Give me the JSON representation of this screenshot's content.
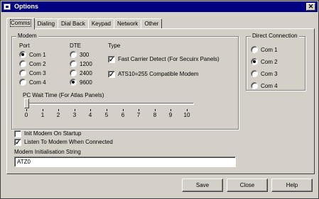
{
  "window": {
    "title": "Options",
    "close_label": "✕"
  },
  "tabs": [
    "Comms",
    "Dialing",
    "Dial Back",
    "Keypad",
    "Network",
    "Other"
  ],
  "active_tab": 0,
  "modem": {
    "group_label": "Modem",
    "port_header": "Port",
    "ports": [
      "Com 1",
      "Com 2",
      "Com 3",
      "Com 4"
    ],
    "selected_port": 0,
    "dte_header": "DTE",
    "dte_rates": [
      "300",
      "1200",
      "2400",
      "9600"
    ],
    "selected_dte": 3,
    "type_header": "Type",
    "types": [
      {
        "label": "Fast Carrier Detect (For Secuirx Panels)",
        "checked": true
      },
      {
        "label": "ATS10=255 Compatible Modem",
        "checked": true
      }
    ],
    "wait_label": "PC Wait Time (For Atlas Panels)",
    "wait_ticks": [
      "0",
      "1",
      "2",
      "3",
      "4",
      "5",
      "6",
      "7",
      "8",
      "9",
      "10"
    ],
    "wait_value": 0
  },
  "direct": {
    "group_label": "Direct Connection",
    "ports": [
      "Com 1",
      "Com 2",
      "Com 3",
      "Com 4"
    ],
    "selected_port": 1
  },
  "options": [
    {
      "label": "Init Modem On Startup",
      "checked": false
    },
    {
      "label": "Listen To Modem When Connected",
      "checked": true
    }
  ],
  "init_string": {
    "label": "Modem Initialisation String",
    "value": "ATZ0"
  },
  "buttons": {
    "save": "Save",
    "close": "Close",
    "help": "Help"
  },
  "colors": {
    "titlebar": "#000080",
    "face": "#d4d0c8"
  }
}
